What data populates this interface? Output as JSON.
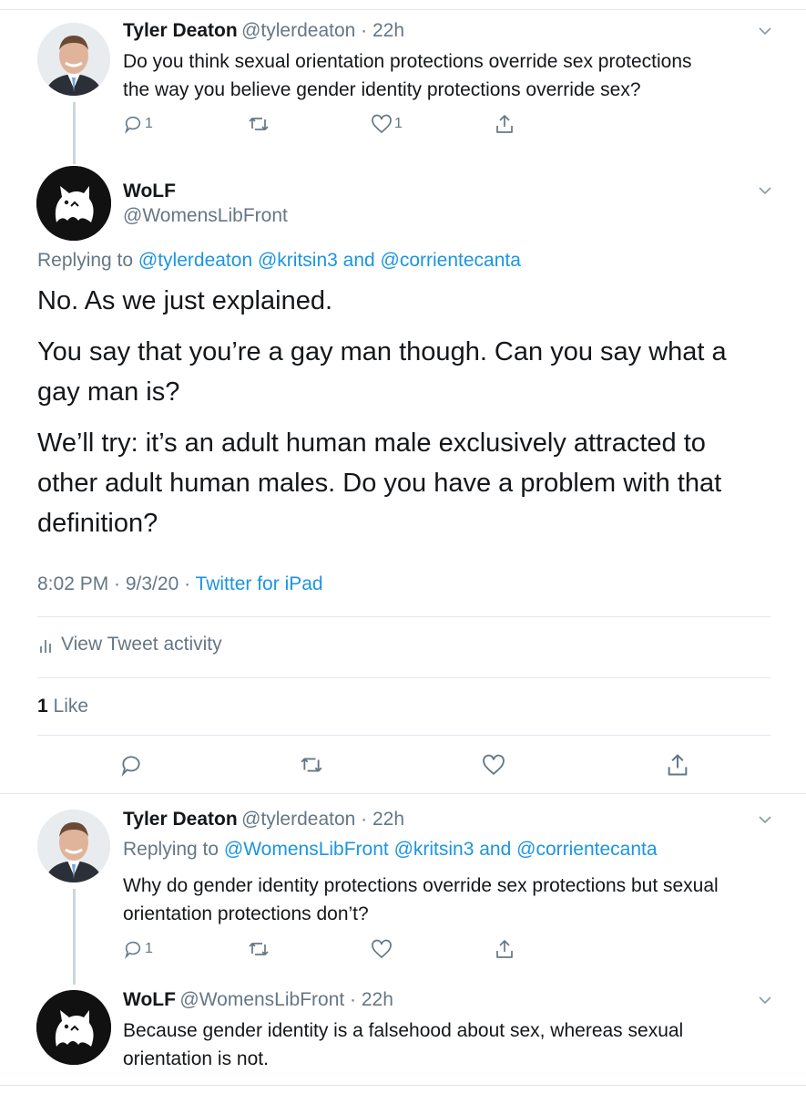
{
  "tweet1": {
    "name": "Tyler Deaton",
    "meta": "@tylerdeaton · 22h",
    "text_line1": "Do you think sexual orientation protections override sex protections",
    "text_line2": "the way you believe gender identity protections override sex?",
    "reply_count": "1",
    "like_count": "1"
  },
  "main": {
    "name": "WoLF",
    "handle": "@WomensLibFront",
    "replying_prefix": "Replying to",
    "replying_users": "@tylerdeaton @kritsin3",
    "replying_and": "and",
    "replying_last": "@corrientecanta",
    "p1": "No. As we just explained.",
    "p2_line1": "You say that you’re a gay man though. Can you say what a",
    "p2_line2": "gay man is?",
    "p3_line1": "We’ll try: it’s an adult human male exclusively attracted to",
    "p3_line2": "other adult human males. Do you have a problem with that",
    "p3_line3": "definition?",
    "timestamp": "8:02 PM · 9/3/20 · ",
    "source": "Twitter for iPad",
    "activity_label": "View Tweet activity",
    "likes_count": "1",
    "likes_label": "Like"
  },
  "tweet3": {
    "name": "Tyler Deaton",
    "meta": "@tylerdeaton · 22h",
    "replying_prefix": "Replying to",
    "replying_users": "@WomensLibFront @kritsin3",
    "replying_and": "and",
    "replying_last": "@corrientecanta",
    "text_line1": "Why do gender identity protections override sex protections but sexual",
    "text_line2": "orientation protections don’t?",
    "reply_count": "1"
  },
  "tweet4": {
    "name": "WoLF",
    "meta": "@WomensLibFront · 22h",
    "text_line1": "Because gender identity is a falsehood about sex, whereas sexual",
    "text_line2": "orientation is not."
  },
  "colors": {
    "link": "#1b95e0",
    "muted": "#657786",
    "divider": "#e1e8ed"
  },
  "icons": [
    "reply-icon",
    "retweet-icon",
    "like-icon",
    "share-icon",
    "chevron-down-icon",
    "bar-chart-icon"
  ]
}
